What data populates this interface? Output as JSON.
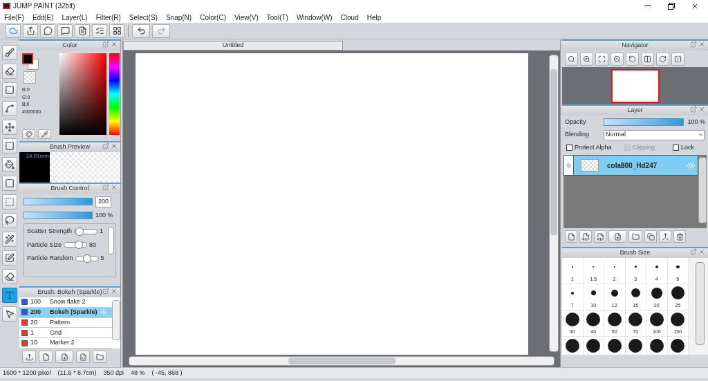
{
  "window": {
    "title": "JUMP PAINT (32bit)"
  },
  "menu": [
    "File(F)",
    "Edit(E)",
    "Layer(L)",
    "Filter(R)",
    "Select(S)",
    "Snap(N)",
    "Color(C)",
    "View(V)",
    "Tool(T)",
    "Window(W)",
    "Cloud",
    "Help"
  ],
  "tools": [
    {
      "kind": "brush",
      "selected": false
    },
    {
      "kind": "eraser",
      "selected": false
    },
    {
      "kind": "square",
      "selected": false
    },
    {
      "kind": "line",
      "selected": false
    },
    {
      "kind": "move",
      "selected": false
    },
    {
      "kind": "fill",
      "selected": false
    },
    {
      "kind": "bucket",
      "selected": false
    },
    {
      "kind": "gradient",
      "selected": false
    },
    {
      "kind": "rect-select",
      "selected": false
    },
    {
      "kind": "lasso",
      "selected": false
    },
    {
      "kind": "wand",
      "selected": false
    },
    {
      "kind": "select-pen",
      "selected": false
    },
    {
      "kind": "select-eraser",
      "selected": false
    },
    {
      "kind": "text",
      "selected": true
    },
    {
      "kind": "pointer",
      "selected": false
    }
  ],
  "color_panel": {
    "title": "Color",
    "r": "R:0",
    "g": "G:0",
    "b": "B:0",
    "hex": "#000000"
  },
  "brush_preview": {
    "title": "Brush Preview",
    "size": "14.51mm"
  },
  "brush_control": {
    "title": "Brush Control",
    "size": {
      "level": 1,
      "value": "200"
    },
    "opacity": {
      "level": 1,
      "value": "100 %"
    },
    "sliders": [
      {
        "label": "Scatter Strength",
        "level": 0.1,
        "value": "1"
      },
      {
        "label": "Particle Size",
        "level": 0.72,
        "value": "80"
      },
      {
        "label": "Particle Random",
        "level": 0.5,
        "value": "5"
      }
    ]
  },
  "brush_list": {
    "title": "Brush: Bokeh (Sparkle)",
    "items": [
      {
        "number": "100",
        "name": "Snow flake 2",
        "color": "#3355ee",
        "selected": false
      },
      {
        "number": "200",
        "name": "Bokeh (Sparkle)",
        "color": "#3355ee",
        "selected": true
      },
      {
        "number": "20",
        "name": "Pattern",
        "color": "#ee3333",
        "selected": false
      },
      {
        "number": "1",
        "name": "Grid",
        "color": "#ee3333",
        "selected": false
      },
      {
        "number": "10",
        "name": "Marker 2",
        "color": "#ee3333",
        "selected": false
      }
    ]
  },
  "canvas": {
    "tab": "Untitled"
  },
  "navigator": {
    "title": "Navigator"
  },
  "layer_panel": {
    "title": "Layer",
    "opacity": {
      "label": "Opacity",
      "level": 1,
      "value": "100 %"
    },
    "blending_label": "Blending",
    "blending": "Normal",
    "options": [
      {
        "label": "Protect Alpha",
        "checked": false,
        "disabled": false
      },
      {
        "label": "Clipping",
        "checked": false,
        "disabled": true
      },
      {
        "label": "Lock",
        "checked": false,
        "disabled": false
      }
    ],
    "layers": [
      {
        "name": "cola800_Hd247",
        "selected": true
      }
    ]
  },
  "brush_size": {
    "title": "Brush Size",
    "sizes": [
      "1",
      "1.5",
      "2",
      "3",
      "4",
      "5",
      "7",
      "10",
      "12",
      "15",
      "20",
      "25",
      "30",
      "40",
      "50",
      "70",
      "100",
      "150"
    ]
  },
  "status_bar": [
    "1600 * 1200 pixel",
    "(11.6 * 8.7cm)",
    "350 dpi",
    "48 %",
    "( -45, 868 )"
  ]
}
